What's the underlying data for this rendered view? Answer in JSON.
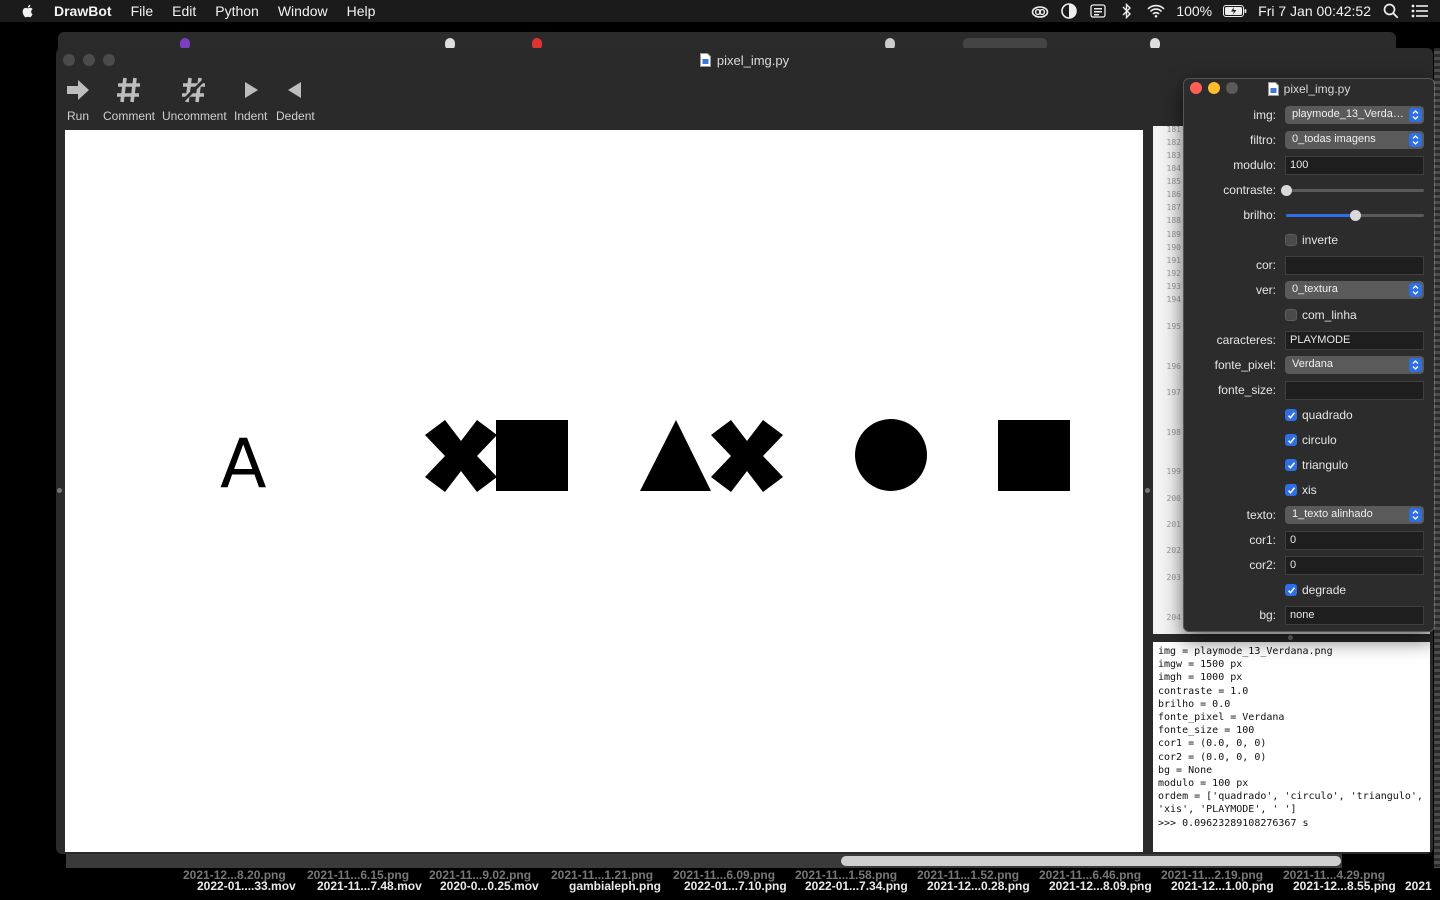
{
  "menubar": {
    "app": "DrawBot",
    "menus": [
      "File",
      "Edit",
      "Python",
      "Window",
      "Help"
    ],
    "battery": "100%",
    "clock": "Fri 7 Jan  00:42:52"
  },
  "window": {
    "title": "pixel_img.py"
  },
  "toolbar": {
    "run": "Run",
    "comment": "Comment",
    "uncomment": "Uncomment",
    "indent": "Indent",
    "dedent": "Dedent"
  },
  "canvas": {
    "letter": "A"
  },
  "code": {
    "line_numbers": [
      "181",
      "182",
      "183",
      "184",
      "185",
      "186",
      "187",
      "188",
      "189",
      "190",
      "191",
      "192",
      "193",
      "194",
      "195",
      "196",
      "197",
      "198",
      "199",
      "200",
      "201",
      "202",
      "203",
      "204"
    ]
  },
  "vars_panel": {
    "title": "pixel_img.py",
    "img": {
      "label": "img:",
      "value": "playmode_13_Verdan..."
    },
    "filtro": {
      "label": "filtro:",
      "value": "0_todas imagens"
    },
    "modulo": {
      "label": "modulo:",
      "value": "100"
    },
    "contraste": {
      "label": "contraste:",
      "level": 0.0
    },
    "brilho": {
      "label": "brilho:",
      "level": 0.5
    },
    "inverte": {
      "label": "inverte",
      "checked": false
    },
    "cor": {
      "label": "cor:",
      "value": ""
    },
    "ver": {
      "label": "ver:",
      "value": "0_textura"
    },
    "com_linha": {
      "label": "com_linha",
      "checked": false
    },
    "caracteres": {
      "label": "caracteres:",
      "value": "PLAYMODE"
    },
    "fonte_pixel": {
      "label": "fonte_pixel:",
      "value": "Verdana"
    },
    "fonte_size": {
      "label": "fonte_size:",
      "value": ""
    },
    "quadrado": {
      "label": "quadrado",
      "checked": true
    },
    "circulo": {
      "label": "circulo",
      "checked": true
    },
    "triangulo": {
      "label": "triangulo",
      "checked": true
    },
    "xis": {
      "label": "xis",
      "checked": true
    },
    "texto": {
      "label": "texto:",
      "value": "1_texto alinhado"
    },
    "cor1": {
      "label": "cor1:",
      "value": "0"
    },
    "cor2": {
      "label": "cor2:",
      "value": "0"
    },
    "degrade": {
      "label": "degrade",
      "checked": true
    },
    "bg": {
      "label": "bg:",
      "value": "none"
    }
  },
  "output": {
    "text": "img = playmode_13_Verdana.png\nimgw = 1500 px\nimgh = 1000 px\ncontraste = 1.0\nbrilho = 0.0\nfonte_pixel = Verdana\nfonte_size = 100\ncor1 = (0.0, 0, 0)\ncor2 = (0.0, 0, 0)\nbg = None\nmodulo = 100 px\nordem = ['quadrado', 'circulo', 'triangulo',\n'xis', 'PLAYMODE', ' ']\n>>> 0.09623289108276367 s"
  },
  "desktop_files": {
    "row_back": [
      "2021-12...8.20.png",
      "2021-11...6.15.png",
      "2021-11...9.02.png",
      "2021-11...1.21.png",
      "2021-11...6.09.png",
      "2021-11...1.58.png",
      "2021-11...1.52.png",
      "2021-11...6.46.png",
      "2021-11...2.19.png",
      "2021-11...4.29.png"
    ],
    "row_front": [
      "2022-01....33.mov",
      "2021-11...7.48.mov",
      "2020-0...0.25.mov",
      "gambialeph.png",
      "2022-01...7.10.png",
      "2022-01...7.34.png",
      "2021-12...0.28.png",
      "2021-12...8.09.png",
      "2021-12...1.00.png",
      "2021-12...8.55.png",
      "2021"
    ]
  },
  "colors": {
    "accent": "#2f6fe4",
    "close": "#ff5f57",
    "minimize": "#febc2e",
    "zoom": "#5a5a5a"
  }
}
